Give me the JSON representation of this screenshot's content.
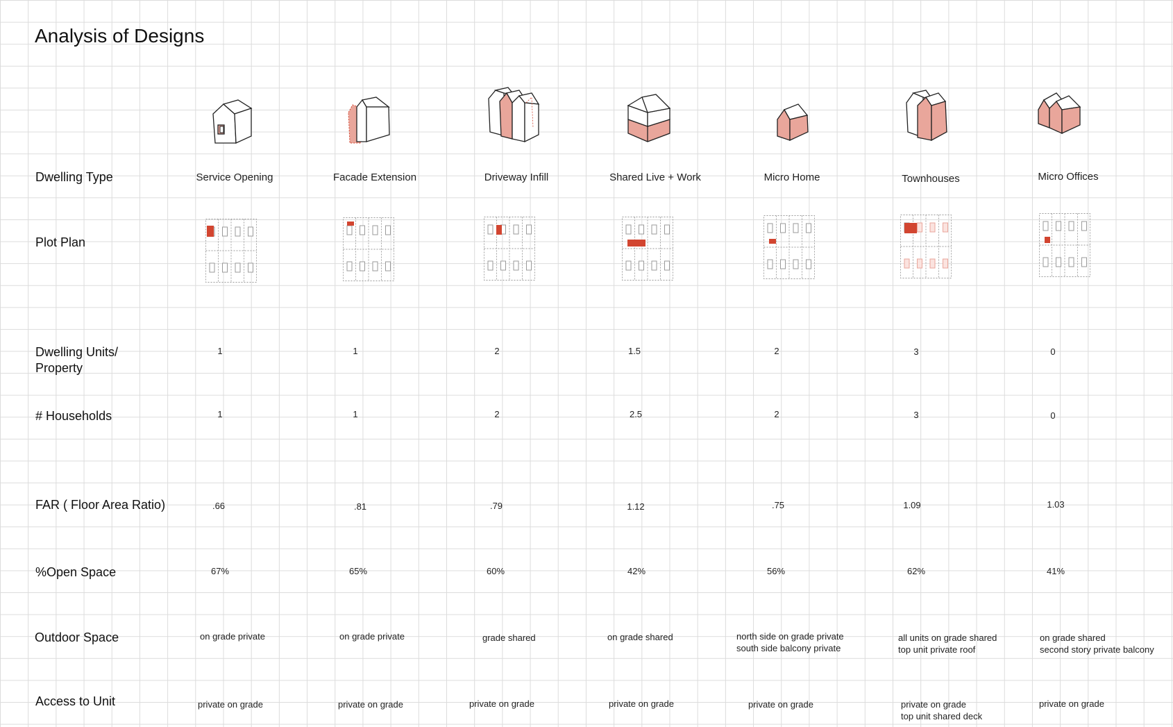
{
  "title": "Analysis of Designs",
  "colors": {
    "accent": "#d24530",
    "accent_light": "#e9a69b",
    "grid": "#dcdcdc",
    "plan_line": "#9a9a9a"
  },
  "row_labels": {
    "dwelling_type": "Dwelling Type",
    "plot_plan": "Plot Plan",
    "dwelling_units": "Dwelling  Units/\nProperty",
    "households": "# Households",
    "far": "FAR ( Floor Area Ratio)",
    "open_space": "%Open Space",
    "outdoor_space": "Outdoor Space",
    "access": "Access to Unit"
  },
  "designs": [
    {
      "name": "Service Opening",
      "icon": "house-with-service-window-icon",
      "units": "1",
      "households": "1",
      "far": ".66",
      "open_space": "67%",
      "outdoor": "on grade private",
      "access": "private on grade"
    },
    {
      "name": "Facade Extension",
      "icon": "house-facade-extension-icon",
      "units": "1",
      "households": "1",
      "far": ".81",
      "open_space": "65%",
      "outdoor": "on grade private",
      "access": "private on grade"
    },
    {
      "name": "Driveway Infill",
      "icon": "houses-driveway-infill-icon",
      "units": "2",
      "households": "2",
      "far": ".79",
      "open_space": "60%",
      "outdoor": "grade shared",
      "access": "private on grade"
    },
    {
      "name": "Shared Live + Work",
      "icon": "house-shared-live-work-icon",
      "units": "1.5",
      "households": "2.5",
      "far": "1.12",
      "open_space": "42%",
      "outdoor": "on grade shared",
      "access": "private on grade"
    },
    {
      "name": "Micro Home",
      "icon": "micro-home-icon",
      "units": "2",
      "households": "2",
      "far": ".75",
      "open_space": "56%",
      "outdoor": "north side on grade private\nsouth side balcony private",
      "access": "private on grade"
    },
    {
      "name": "Townhouses",
      "icon": "townhouses-icon",
      "units": "3",
      "households": "3",
      "far": "1.09",
      "open_space": "62%",
      "outdoor": "all units on grade shared\ntop unit private roof",
      "access": "private on grade\ntop unit shared deck"
    },
    {
      "name": "Micro Offices",
      "icon": "micro-offices-icon",
      "units": "0",
      "households": "0",
      "far": "1.03",
      "open_space": "41%",
      "outdoor": "on grade shared\nsecond story private balcony",
      "access": "private on grade"
    }
  ]
}
